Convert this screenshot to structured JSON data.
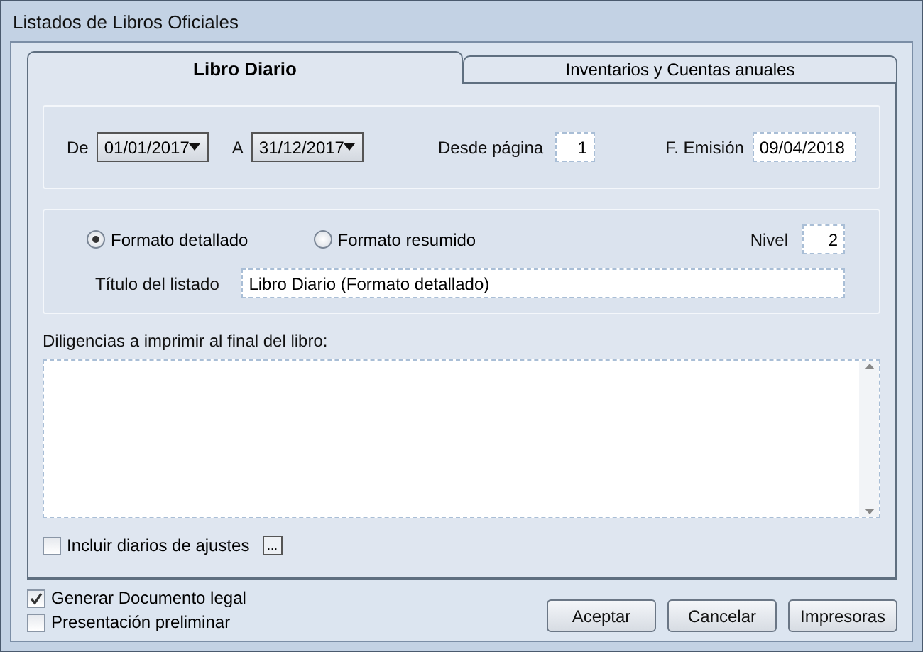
{
  "window": {
    "title": "Listados de Libros Oficiales"
  },
  "tabs": [
    {
      "label": "Libro Diario",
      "selected": true
    },
    {
      "label": "Inventarios y Cuentas anuales",
      "selected": false
    }
  ],
  "range": {
    "from_label": "De",
    "from_value": "01/01/2017",
    "to_label": "A",
    "to_value": "31/12/2017",
    "page_label": "Desde página",
    "page_value": "1",
    "date_label": "F. Emisión",
    "date_value": "09/04/2018"
  },
  "format": {
    "options": [
      {
        "label": "Formato detallado",
        "selected": true
      },
      {
        "label": "Formato resumido",
        "selected": false
      }
    ],
    "level_label": "Nivel",
    "level_value": "2",
    "title_label": "Título del listado",
    "title_value": "Libro Diario (Formato detallado)"
  },
  "notes": {
    "label": "Diligencias a imprimir al final del libro:"
  },
  "include_adjustments": {
    "label": "Incluir diarios de ajustes",
    "checked": false,
    "button": "..."
  },
  "options": [
    {
      "label": "Generar Documento legal",
      "checked": true
    },
    {
      "label": "Presentación preliminar",
      "checked": false
    }
  ],
  "buttons": [
    "Aceptar",
    "Cancelar",
    "Impresoras"
  ]
}
